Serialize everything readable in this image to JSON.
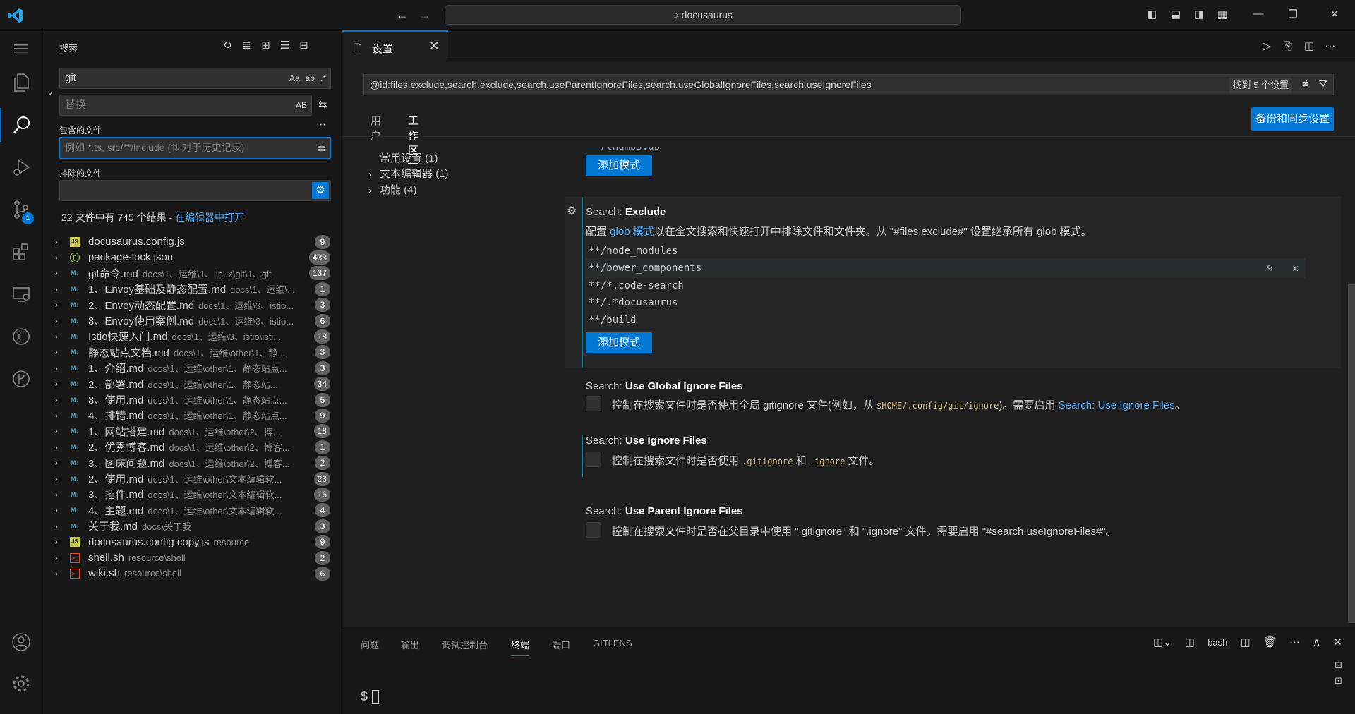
{
  "titlebar": {
    "command_center": "docusaurus",
    "colors": {
      "accent": "#0078d4",
      "logo": "#23a9f2"
    }
  },
  "activitybar": {
    "items": [
      "menu",
      "explorer",
      "search",
      "run-debug",
      "source-control",
      "extensions",
      "remote-explorer",
      "gitlens",
      "gitlens-inspect"
    ],
    "source_control_badge": "1"
  },
  "sidebar": {
    "title": "搜索",
    "search_value": "git",
    "replace_placeholder": "替换",
    "include_label": "包含的文件",
    "include_placeholder": "例如 *.ts, src/**/include (⇅ 对于历史记录)",
    "exclude_label": "排除的文件",
    "search_opts": [
      "Aa",
      "ab",
      ".*"
    ],
    "replace_opt": "AB",
    "summary": "22 文件中有 745 个结果 - ",
    "summary_link": "在编辑器中打开",
    "results": [
      {
        "icon": "js",
        "name": "docusaurus.config.js",
        "path": "",
        "count": "9"
      },
      {
        "icon": "json",
        "name": "package-lock.json",
        "path": "",
        "count": "433"
      },
      {
        "icon": "md",
        "name": "git命令.md",
        "path": "docs\\1、运维\\1、linux\\git\\1、git",
        "count": "137"
      },
      {
        "icon": "md",
        "name": "1、Envoy基础及静态配置.md",
        "path": "docs\\1、运维\\...",
        "count": "1"
      },
      {
        "icon": "md",
        "name": "2、Envoy动态配置.md",
        "path": "docs\\1、运维\\3、istio...",
        "count": "3"
      },
      {
        "icon": "md",
        "name": "3、Envoy使用案例.md",
        "path": "docs\\1、运维\\3、istio...",
        "count": "6"
      },
      {
        "icon": "md",
        "name": "Istio快速入门.md",
        "path": "docs\\1、运维\\3、istio\\isti...",
        "count": "18"
      },
      {
        "icon": "md",
        "name": "静态站点文档.md",
        "path": "docs\\1、运维\\other\\1、静...",
        "count": "3"
      },
      {
        "icon": "md",
        "name": "1、介绍.md",
        "path": "docs\\1、运维\\other\\1、静态站点...",
        "count": "3"
      },
      {
        "icon": "md",
        "name": "2、部署.md",
        "path": "docs\\1、运维\\other\\1、静态站...",
        "count": "34"
      },
      {
        "icon": "md",
        "name": "3、使用.md",
        "path": "docs\\1、运维\\other\\1、静态站点...",
        "count": "5"
      },
      {
        "icon": "md",
        "name": "4、排错.md",
        "path": "docs\\1、运维\\other\\1、静态站点...",
        "count": "9"
      },
      {
        "icon": "md",
        "name": "1、网站搭建.md",
        "path": "docs\\1、运维\\other\\2、博...",
        "count": "18"
      },
      {
        "icon": "md",
        "name": "2、优秀博客.md",
        "path": "docs\\1、运维\\other\\2、博客...",
        "count": "1"
      },
      {
        "icon": "md",
        "name": "3、图床问题.md",
        "path": "docs\\1、运维\\other\\2、博客...",
        "count": "2"
      },
      {
        "icon": "md",
        "name": "2、使用.md",
        "path": "docs\\1、运维\\other\\文本编辑软...",
        "count": "23"
      },
      {
        "icon": "md",
        "name": "3、插件.md",
        "path": "docs\\1、运维\\other\\文本编辑软...",
        "count": "16"
      },
      {
        "icon": "md",
        "name": "4、主题.md",
        "path": "docs\\1、运维\\other\\文本编辑软...",
        "count": "4"
      },
      {
        "icon": "md",
        "name": "关于我.md",
        "path": "docs\\关于我",
        "count": "3"
      },
      {
        "icon": "js",
        "name": "docusaurus.config copy.js",
        "path": "resource",
        "count": "9"
      },
      {
        "icon": "sh",
        "name": "shell.sh",
        "path": "resource\\shell",
        "count": "2"
      },
      {
        "icon": "sh",
        "name": "wiki.sh",
        "path": "resource\\shell",
        "count": "6"
      }
    ]
  },
  "editor": {
    "tab_label": "设置",
    "search_query": "@id:files.exclude,search.exclude,search.useParentIgnoreFiles,search.useGlobalIgnoreFiles,search.useIgnoreFiles",
    "found_label": "找到 5 个设置",
    "scope_tabs": [
      "用户",
      "工作区"
    ],
    "active_scope": "工作区",
    "sync_button": "备份和同步设置",
    "toc": [
      {
        "label": "常用设置",
        "count": "(1)",
        "expandable": false
      },
      {
        "label": "文本编辑器",
        "count": "(1)",
        "expandable": true
      },
      {
        "label": "功能",
        "count": "(4)",
        "expandable": true
      }
    ],
    "add_pattern": "添加模式",
    "cut_off_text": "**/thumbs.db",
    "search_exclude": {
      "title_prefix": "Search: ",
      "title_name": "Exclude",
      "desc_before": "配置 ",
      "desc_link": "glob 模式",
      "desc_after": "以在全文搜索和快速打开中排除文件和文件夹。从 \"#files.exclude#\" 设置继承所有 glob 模式。",
      "patterns": [
        "**/node_modules",
        "**/bower_components",
        "**/*.code-search",
        "**/.*docusaurus",
        "**/build"
      ]
    },
    "global_ignore": {
      "title_prefix": "Search: ",
      "title_name": "Use Global Ignore Files",
      "desc_1": "控制在搜索文件时是否使用全局 gitignore 文件(例如，从 ",
      "desc_code": "$HOME/.config/git/ignore",
      "desc_2": ")。需要启用 ",
      "desc_link": "Search: Use Ignore Files",
      "desc_3": "。"
    },
    "use_ignore": {
      "title_prefix": "Search: ",
      "title_name": "Use Ignore Files",
      "desc_1": "控制在搜索文件时是否使用 ",
      "code_1": ".gitignore",
      "desc_2": " 和 ",
      "code_2": ".ignore",
      "desc_3": " 文件。"
    },
    "parent_ignore": {
      "title_prefix": "Search: ",
      "title_name": "Use Parent Ignore Files",
      "desc": "控制在搜索文件时是否在父目录中使用 \".gitignore\" 和 \".ignore\" 文件。需要启用 \"#search.useIgnoreFiles#\"。"
    }
  },
  "panel": {
    "tabs": [
      "问题",
      "输出",
      "调试控制台",
      "终端",
      "端口",
      "GITLENS"
    ],
    "active_tab": "终端",
    "shell_label": "bash",
    "prompt": "$"
  }
}
